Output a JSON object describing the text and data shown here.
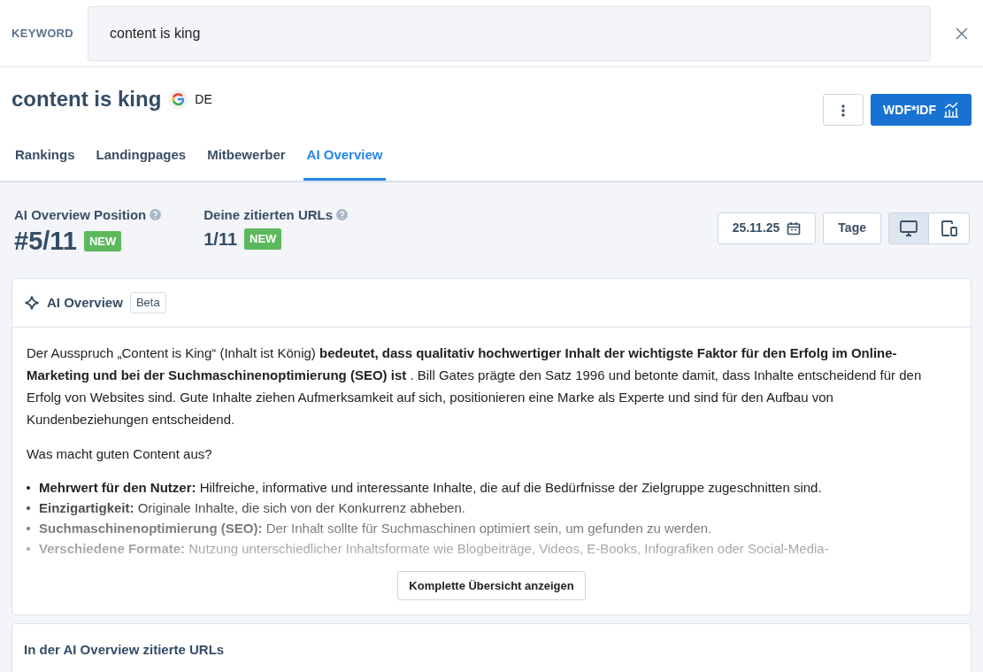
{
  "keyword_bar": {
    "label": "KEYWORD",
    "value": "content is king"
  },
  "header": {
    "title": "content is king",
    "country": "DE",
    "wdf_button": "WDF*IDF"
  },
  "tabs": [
    {
      "label": "Rankings",
      "selected": false
    },
    {
      "label": "Landingpages",
      "selected": false
    },
    {
      "label": "Mitbewerber",
      "selected": false
    },
    {
      "label": "AI Overview",
      "selected": true
    }
  ],
  "stats": [
    {
      "label": "AI Overview Position",
      "value": "#5/11",
      "badge": "NEW"
    },
    {
      "label": "Deine zitierten URLs",
      "value": "1/11",
      "badge": "NEW"
    }
  ],
  "toolbar": {
    "date": "25.11.25",
    "period": "Tage",
    "devices": [
      {
        "kind": "desktop",
        "selected": true
      },
      {
        "kind": "mobile",
        "selected": false
      }
    ]
  },
  "overview_card": {
    "title": "AI Overview",
    "badge": "Beta",
    "paragraphs": [
      "Der Ausspruch „Content is King“ (Inhalt ist König) **bedeutet, dass qualitativ hochwertiger Inhalt der wichtigste Faktor für den Erfolg im Online-Marketing und bei der Suchmaschinenoptimierung (SEO) ist** . Bill Gates prägte den Satz 1996 und betonte damit, dass Inhalte entscheidend für den Erfolg von Websites sind. Gute Inhalte ziehen Aufmerksamkeit auf sich, positionieren eine Marke als Experte und sind für den Aufbau von Kundenbeziehungen entscheidend.",
      "Was macht guten Content aus?"
    ],
    "bullets": [
      "**Mehrwert für den Nutzer:** Hilfreiche, informative und interessante Inhalte, die auf die Bedürfnisse der Zielgruppe zugeschnitten sind.",
      "**Einzigartigkeit:** Originale Inhalte, die sich von der Konkurrenz abheben.",
      "**Suchmaschinenoptimierung (SEO):** Der Inhalt sollte für Suchmaschinen optimiert sein, um gefunden zu werden.",
      "**Verschiedene Formate:** Nutzung unterschiedlicher Inhaltsformate wie Blogbeiträge, Videos, E-Books, Infografiken oder Social-Media-"
    ],
    "button": "Komplette Übersicht anzeigen"
  },
  "cited_card": {
    "title": "In der AI Overview zitierte URLs"
  }
}
